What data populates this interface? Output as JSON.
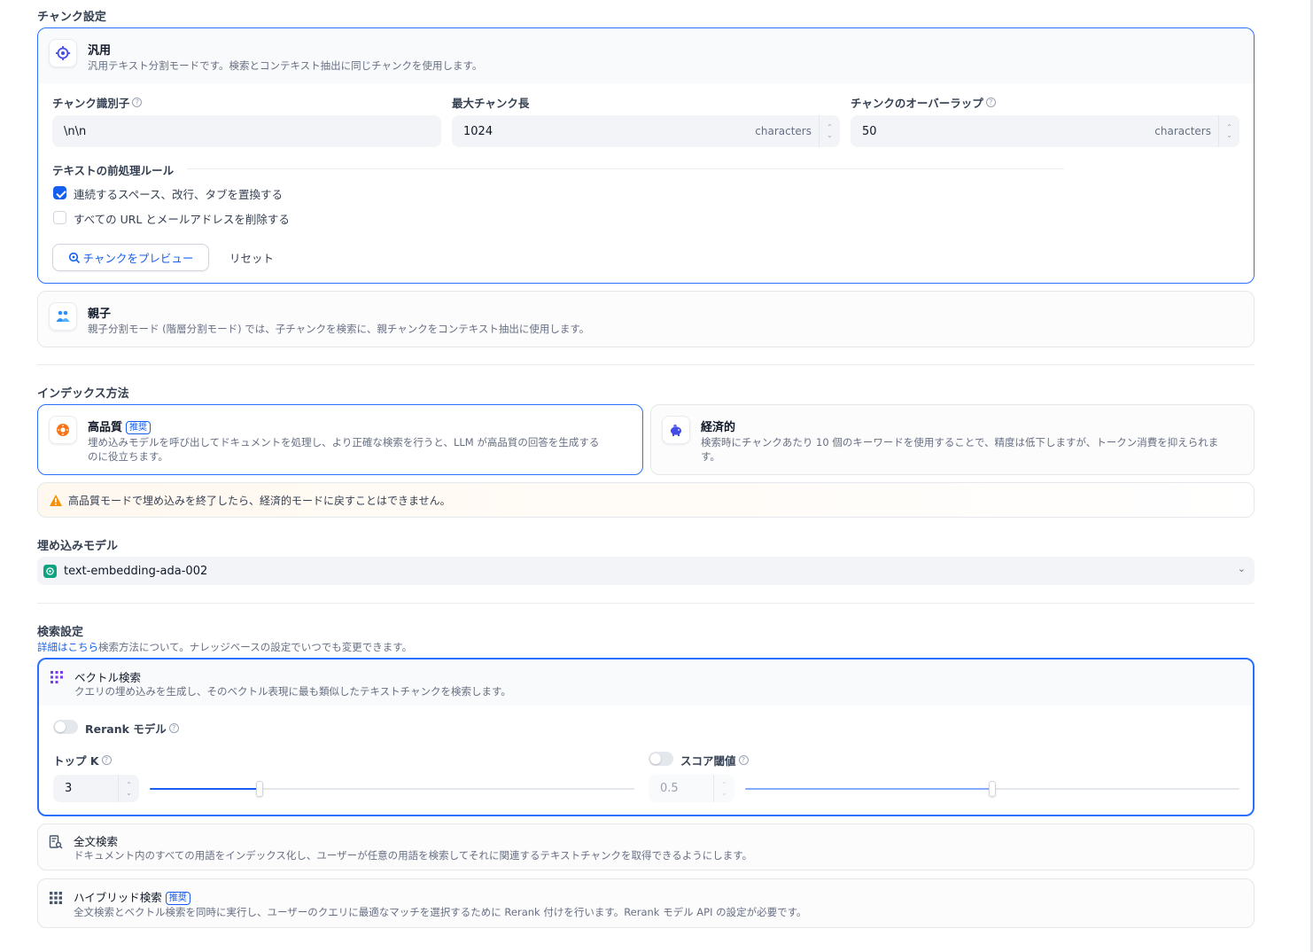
{
  "chunk_settings": {
    "title": "チャンク設定",
    "general": {
      "title": "汎用",
      "desc": "汎用テキスト分割モードです。検索とコンテキスト抽出に同じチャンクを使用します。",
      "delimiter_label": "チャンク識別子",
      "delimiter_value": "\\n\\n",
      "max_length_label": "最大チャンク長",
      "max_length_value": "1024",
      "overlap_label": "チャンクのオーバーラップ",
      "overlap_value": "50",
      "unit": "characters",
      "rules_label": "テキストの前処理ルール",
      "rules": [
        {
          "label": "連続するスペース、改行、タブを置換する",
          "checked": true
        },
        {
          "label": "すべての URL とメールアドレスを削除する",
          "checked": false
        }
      ],
      "preview_button": "チャンクをプレビュー",
      "reset_button": "リセット"
    },
    "parent_child": {
      "title": "親子",
      "desc": "親子分割モード (階層分割モード) では、子チャンクを検索に、親チャンクをコンテキスト抽出に使用します。"
    }
  },
  "index_method": {
    "title": "インデックス方法",
    "high_quality": {
      "title": "高品質",
      "badge": "推奨",
      "desc_line1": "埋め込みモデルを呼び出してドキュメントを処理し、より正確な検索を行うと、LLM が高品質の回答を生成する",
      "desc_line2": "のに役立ちます。"
    },
    "economy": {
      "title": "経済的",
      "desc_line1": "検索時にチャンクあたり 10 個のキーワードを使用することで、精度は低下しますが、トークン消費を抑えられま",
      "desc_line2": "す。"
    },
    "warning": "高品質モードで埋め込みを終了したら、経済的モードに戻すことはできません。"
  },
  "embedding": {
    "title": "埋め込みモデル",
    "model": "text-embedding-ada-002"
  },
  "retrieval": {
    "title": "検索設定",
    "link": "詳細はこちら",
    "subtitle": "検索方法について。ナレッジベースの設定でいつでも変更できます。",
    "vector": {
      "title": "ベクトル検索",
      "desc": "クエリの埋め込みを生成し、そのベクトル表現に最も類似したテキストチャンクを検索します。",
      "rerank_label": "Rerank モデル",
      "rerank_enabled": false,
      "topk_label": "トップ K",
      "topk_value": "3",
      "topk_fraction": 0.226,
      "score_label": "スコア閾値",
      "score_enabled": false,
      "score_value": "0.5",
      "score_fraction": 0.5
    },
    "fulltext": {
      "title": "全文検索",
      "desc": "ドキュメント内のすべての用語をインデックス化し、ユーザーが任意の用語を検索してそれに関連するテキストチャンクを取得できるようにします。"
    },
    "hybrid": {
      "title": "ハイブリッド検索",
      "badge": "推奨",
      "desc": "全文検索とベクトル検索を同時に実行し、ユーザーのクエリに最適なマッチを選択するために Rerank 付けを行います。Rerank モデル API の設定が必要です。"
    }
  }
}
